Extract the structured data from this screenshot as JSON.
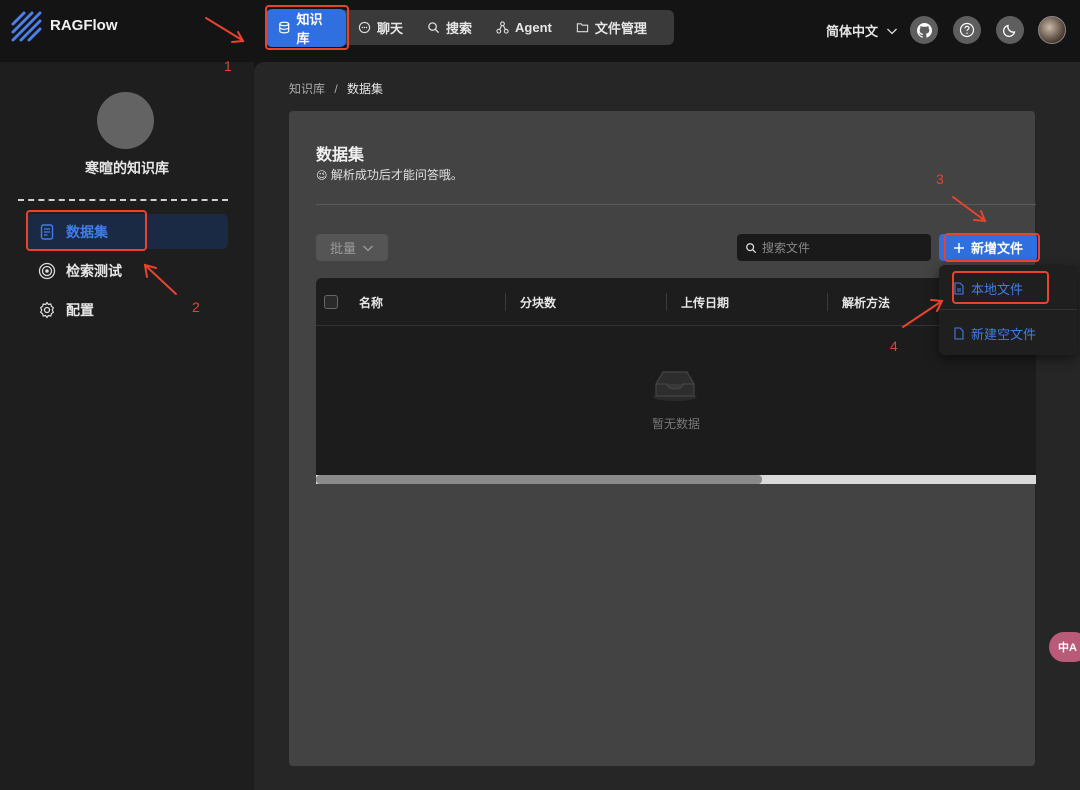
{
  "app": {
    "name": "RAGFlow"
  },
  "nav": {
    "items": [
      {
        "label": "知识库",
        "icon": "database-icon",
        "active": true
      },
      {
        "label": "聊天",
        "icon": "chat-icon",
        "active": false
      },
      {
        "label": "搜索",
        "icon": "search-icon",
        "active": false
      },
      {
        "label": "Agent",
        "icon": "agent-icon",
        "active": false
      },
      {
        "label": "文件管理",
        "icon": "folder-icon",
        "active": false
      }
    ]
  },
  "header": {
    "language": "简体中文"
  },
  "sidebar": {
    "kb_name": "寒暄的知识库",
    "items": [
      {
        "label": "数据集",
        "icon": "document-icon",
        "active": true
      },
      {
        "label": "检索测试",
        "icon": "target-icon",
        "active": false
      },
      {
        "label": "配置",
        "icon": "gear-icon",
        "active": false
      }
    ]
  },
  "breadcrumb": {
    "parent": "知识库",
    "separator": "/",
    "current": "数据集"
  },
  "dataset": {
    "title": "数据集",
    "subtitle": "解析成功后才能问答哦。",
    "subtitle_emoji": "😉",
    "bulk_label": "批量",
    "search_placeholder": "搜索文件",
    "add_label": "新增文件",
    "columns": [
      "名称",
      "分块数",
      "上传日期",
      "解析方法"
    ],
    "empty_text": "暂无数据",
    "scroll_fraction": 0.62
  },
  "add_menu": {
    "items": [
      {
        "label": "本地文件",
        "icon": "file-icon"
      },
      {
        "label": "新建空文件",
        "icon": "file-icon"
      }
    ]
  },
  "translate": {
    "label": "中A"
  },
  "annotations": [
    "1",
    "2",
    "3",
    "4"
  ],
  "colors": {
    "accent": "#2f6fe0",
    "annotation": "#e8432e"
  }
}
